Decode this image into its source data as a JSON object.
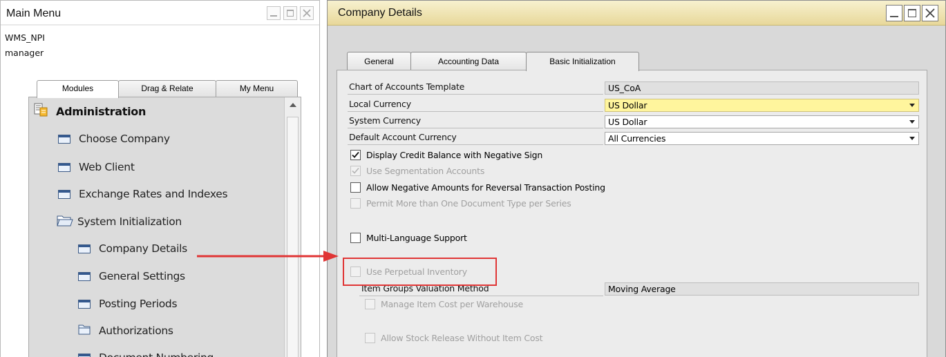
{
  "main_menu": {
    "title": "Main Menu",
    "company_db": "WMS_NPI",
    "user": "manager",
    "tabs": [
      {
        "label": "Modules",
        "active": true
      },
      {
        "label": "Drag & Relate",
        "active": false
      },
      {
        "label": "My Menu",
        "active": false
      }
    ],
    "items": [
      {
        "label": "Administration",
        "icon": "module-list-icon",
        "level": 0,
        "header": true
      },
      {
        "label": "Choose Company",
        "icon": "window-icon",
        "level": 1
      },
      {
        "label": "Web Client",
        "icon": "window-icon",
        "level": 1
      },
      {
        "label": "Exchange Rates and Indexes",
        "icon": "window-icon",
        "level": 1
      },
      {
        "label": "System Initialization",
        "icon": "folder-open-icon",
        "level": 1
      },
      {
        "label": "Company Details",
        "icon": "window-icon",
        "level": 2
      },
      {
        "label": "General Settings",
        "icon": "window-icon",
        "level": 2
      },
      {
        "label": "Posting Periods",
        "icon": "window-icon",
        "level": 2
      },
      {
        "label": "Authorizations",
        "icon": "folder-icon",
        "level": 2
      },
      {
        "label": "Document Numbering",
        "icon": "window-icon",
        "level": 2
      }
    ]
  },
  "company_details": {
    "title": "Company Details",
    "tabs": [
      {
        "label": "General",
        "active": false
      },
      {
        "label": "Accounting Data",
        "active": false
      },
      {
        "label": "Basic Initialization",
        "active": true
      }
    ],
    "fields": {
      "chart_template": {
        "label": "Chart of Accounts Template",
        "value": "US_CoA"
      },
      "local_currency": {
        "label": "Local Currency",
        "value": "US Dollar"
      },
      "system_currency": {
        "label": "System Currency",
        "value": "US Dollar"
      },
      "default_account_currency": {
        "label": "Default Account Currency",
        "value": "All Currencies"
      },
      "item_groups_valuation": {
        "label": "Item Groups Valuation Method",
        "value": "Moving Average"
      }
    },
    "checkboxes": {
      "display_credit_negative": {
        "label": "Display Credit Balance with Negative Sign",
        "checked": true,
        "enabled": true
      },
      "use_segmentation": {
        "label": "Use Segmentation Accounts",
        "checked": true,
        "enabled": false
      },
      "allow_negative_reversal": {
        "label": "Allow Negative Amounts for Reversal Transaction Posting",
        "checked": false,
        "enabled": true
      },
      "permit_multi_doc_type": {
        "label": "Permit More than One Document Type per Series",
        "checked": false,
        "enabled": false
      },
      "multi_language": {
        "label": "Multi-Language Support",
        "checked": false,
        "enabled": true
      },
      "perpetual_inventory": {
        "label": "Use Perpetual Inventory",
        "checked": false,
        "enabled": false
      },
      "manage_cost_per_warehouse": {
        "label": "Manage Item Cost per Warehouse",
        "checked": false,
        "enabled": false
      },
      "allow_stock_release": {
        "label": "Allow Stock Release Without Item Cost",
        "checked": false,
        "enabled": false
      }
    }
  },
  "annotation": {
    "color": "#e03535"
  },
  "colors": {
    "title_gradient_top": "#f7f1cf",
    "title_gradient_bottom": "#e8d89a",
    "highlight_field": "#fff59d"
  }
}
